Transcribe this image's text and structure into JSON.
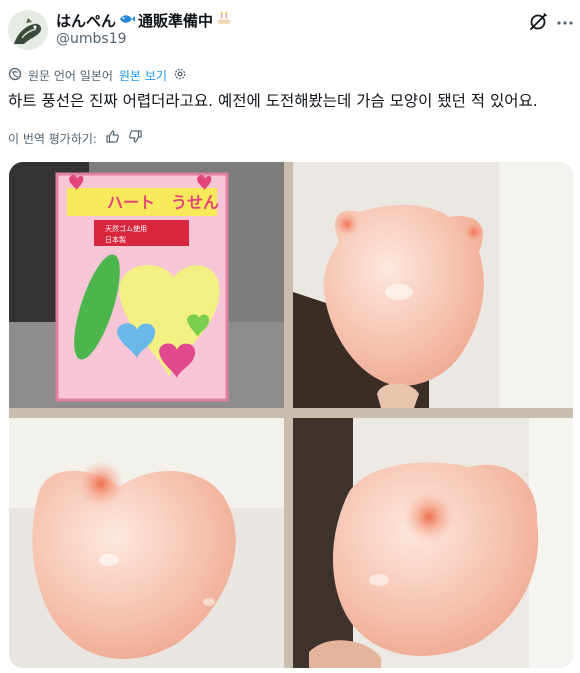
{
  "user": {
    "display_name": "はんぺん",
    "status_text": "通販準備中",
    "handle": "@umbs19",
    "badge_icon": "blue-fish-emoji-icon",
    "status_icon": "birthday-cake-emoji-icon"
  },
  "translation": {
    "source_label": "원문 언어 일본어",
    "show_original": "원본 보기"
  },
  "post": {
    "text": "하트 풍선은 진짜 어렵더라고요. 예전에 도전해봤는데 가슴 모양이 됐던 적 있어요."
  },
  "rating": {
    "label": "이 번역 평가하기:"
  },
  "media": {
    "package_label": "ハート　うせん",
    "package_sublabel_1": "天然ゴム使用",
    "package_sublabel_2": "日本製",
    "photo_count": 4
  },
  "colors": {
    "link": "#1d9bf0",
    "secondary_text": "#536471",
    "primary_text": "#0f1419",
    "balloon": "#f3b5a3"
  },
  "icons": [
    "grok-icon",
    "more-options-icon",
    "translate-icon",
    "gear-icon",
    "thumbs-up-icon",
    "thumbs-down-icon"
  ]
}
